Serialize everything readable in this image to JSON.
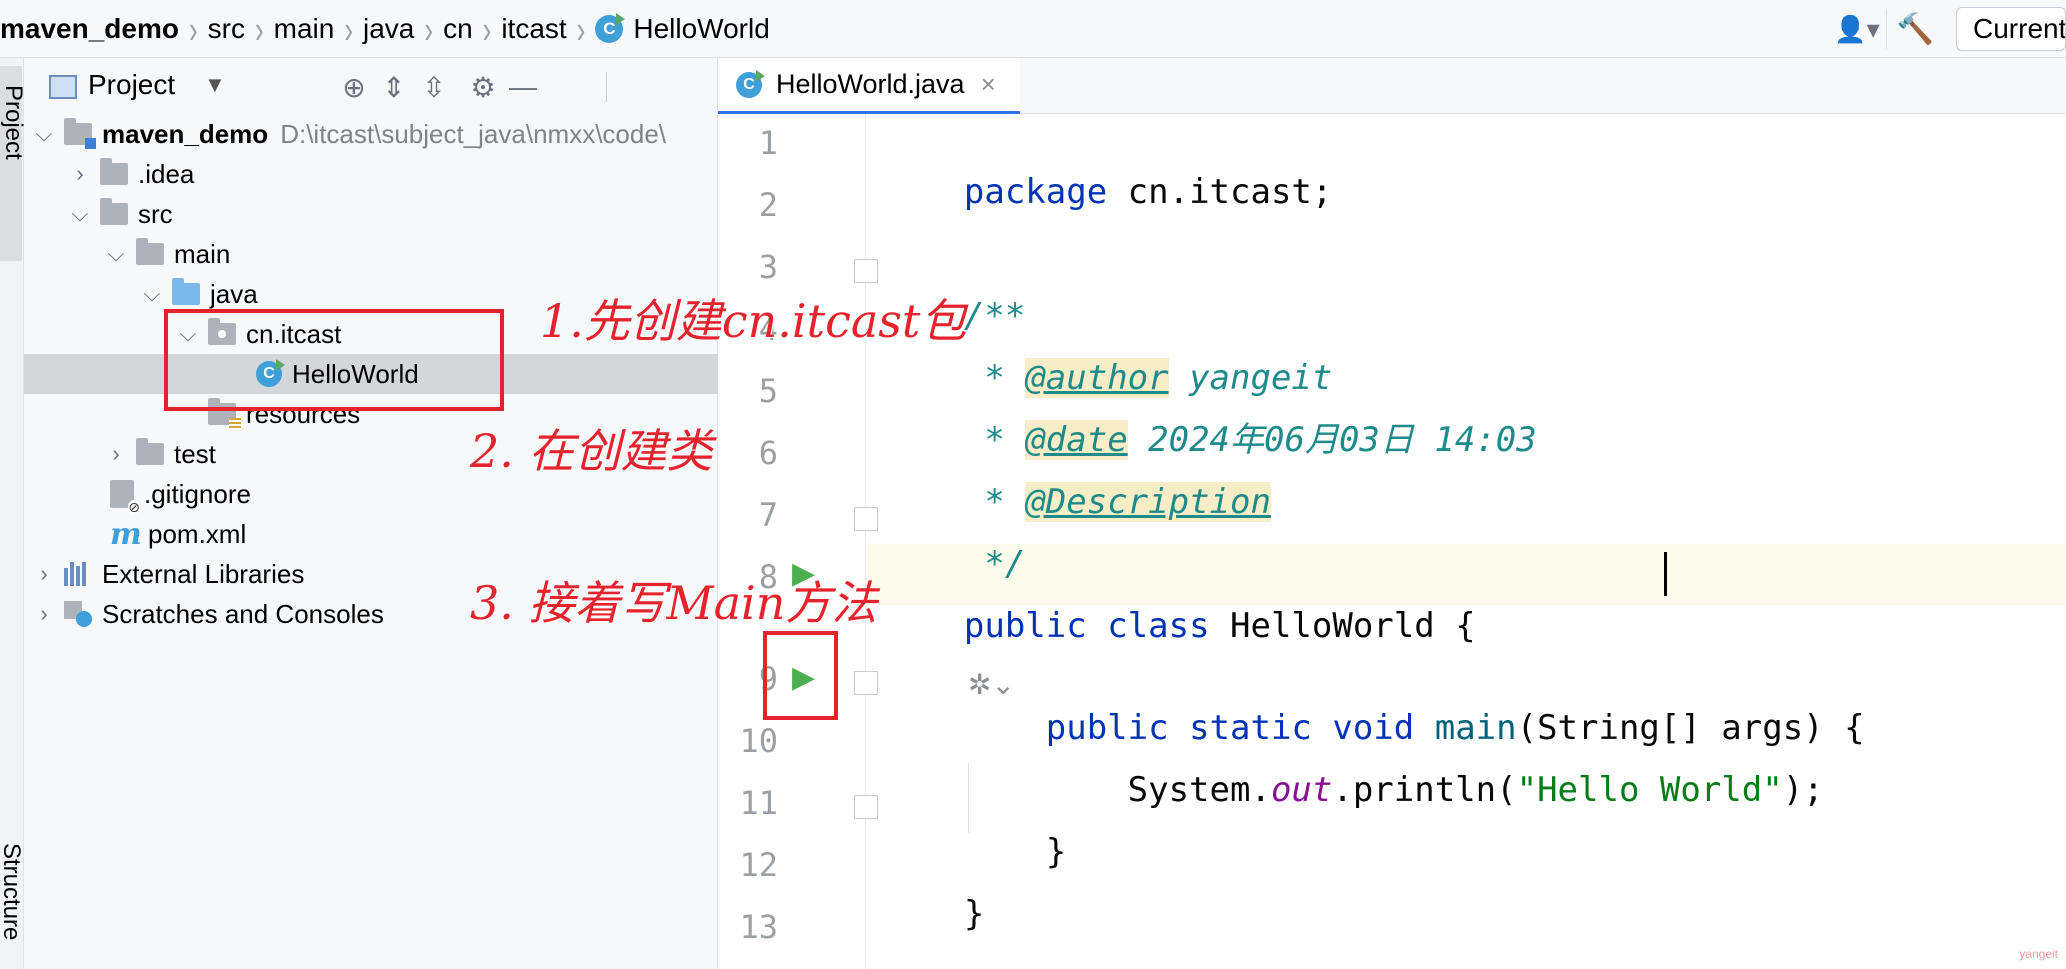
{
  "breadcrumb": {
    "items": [
      "maven_demo",
      "src",
      "main",
      "java",
      "cn",
      "itcast",
      "HelloWorld"
    ]
  },
  "toolbar": {
    "run_config_label": "Current File",
    "user_icon": "user-icon",
    "build_icon": "hammer-icon"
  },
  "tool_strip": {
    "project_label": "Project",
    "structure_label": "Structure"
  },
  "project_panel": {
    "title": "Project",
    "tree": {
      "root_name": "maven_demo",
      "root_path": "D:\\itcast\\subject_java\\nmxx\\code\\",
      "idea": ".idea",
      "src": "src",
      "main": "main",
      "java": "java",
      "package": "cn.itcast",
      "class": "HelloWorld",
      "resources": "resources",
      "test": "test",
      "gitignore": ".gitignore",
      "pom": "pom.xml",
      "external_libraries": "External Libraries",
      "scratches": "Scratches and Consoles"
    }
  },
  "editor": {
    "tab_label": "HelloWorld.java",
    "line_numbers": [
      "1",
      "2",
      "3",
      "4",
      "5",
      "6",
      "7",
      "8",
      "9",
      "10",
      "11",
      "12",
      "13"
    ],
    "code": {
      "l1_kw": "package",
      "l1_rest": " cn.itcast;",
      "l3": "/**",
      "l4_star": " * ",
      "l4_tag": "@author",
      "l4_val": " yangeit",
      "l5_star": " * ",
      "l5_tag": "@date",
      "l5_val": " 2024年06月03日 14:03",
      "l6_star": " * ",
      "l6_tag": "@Description",
      "l7": " */",
      "l8_kw1": "public",
      "l8_kw2": " class",
      "l8_rest": " HelloWorld {",
      "l9_kw1": "    public",
      "l9_kw2": " static",
      "l9_kw3": " void",
      "l9_mth": " main",
      "l9_rest": "(String[] args) {",
      "l10_a": "        System.",
      "l10_field": "out",
      "l10_b": ".println(",
      "l10_str": "\"Hello World\"",
      "l10_c": ");",
      "l11": "    }",
      "l12": "}"
    },
    "watermark": "yangeit"
  },
  "annotations": {
    "step1": "1.先创建cn.itcast包",
    "step2": "2.  在创建类",
    "step3": "3.  接着写Main方法"
  },
  "colors": {
    "annotation_red": "#e5232c",
    "accent_blue": "#3574f0",
    "run_green": "#4caf50"
  }
}
